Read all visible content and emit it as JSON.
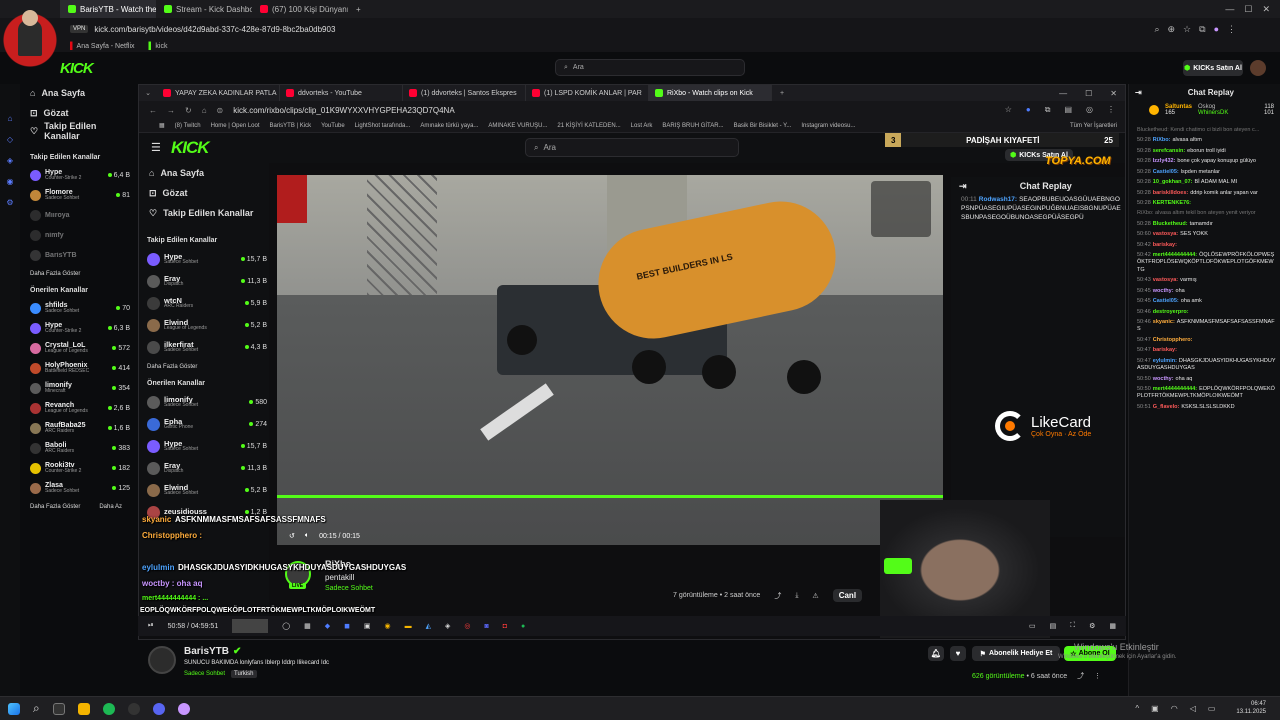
{
  "outer_tabs": [
    {
      "label": "BarisYTB - Watch the",
      "active": true
    },
    {
      "label": "Stream - Kick Dashboard",
      "active": false
    },
    {
      "label": "(67) 100 Kişi Dünyanın En",
      "active": false
    }
  ],
  "outer_address": "kick.com/barisytb/videos/d42d9abd-337c-428e-87d9-8bc2ba0db903",
  "outer_bookmarks": [
    "Ana Sayfa - Netflix",
    "kick"
  ],
  "outer_search_placeholder": "Ara",
  "kicks_buy_label": "KICKs Satın Al",
  "logo_text": "KICK",
  "outer_nav": {
    "home": "Ana Sayfa",
    "browse": "Gözat",
    "following": "Takip Edilen Kanallar"
  },
  "outer_followed_title": "Takip Edilen Kanallar",
  "outer_followed": [
    {
      "name": "Hype",
      "game": "Counter-Strike 2",
      "count": "6,4 B",
      "color": "#7a5cff"
    },
    {
      "name": "Flomore",
      "game": "Sadece Sohbet",
      "count": "81",
      "color": "#c0873a"
    },
    {
      "name": "Mııroya",
      "game": "",
      "count": "",
      "color": "#555"
    },
    {
      "name": "nimfy",
      "game": "",
      "count": "",
      "color": "#555"
    },
    {
      "name": "BarisYTB",
      "game": "",
      "count": "",
      "color": "#666"
    }
  ],
  "outer_show_more": "Daha Fazla Göster",
  "outer_recommended_title": "Önerilen Kanallar",
  "outer_recommended": [
    {
      "name": "shfilds",
      "game": "Sadece Sohbet",
      "count": "70",
      "color": "#3a8cff"
    },
    {
      "name": "Hype",
      "game": "Counter-Strike 2",
      "count": "6,3 B",
      "color": "#7a5cff"
    },
    {
      "name": "Crystal_LoL",
      "game": "League of Legends",
      "count": "572",
      "color": "#d86aa0"
    },
    {
      "name": "HolyPhoenix",
      "game": "Battlefield REDSEC",
      "count": "414",
      "color": "#c04a2a"
    },
    {
      "name": "limonify",
      "game": "Minecraft",
      "count": "354",
      "color": "#5b5b5b"
    },
    {
      "name": "Revanch",
      "game": "League of Legends",
      "count": "2,6 B",
      "color": "#aa3333"
    },
    {
      "name": "RaufBaba25",
      "game": "ARC Raiders",
      "count": "1,6 B",
      "color": "#887755"
    },
    {
      "name": "Baboli",
      "game": "ARC Raiders",
      "count": "383",
      "color": "#333"
    },
    {
      "name": "Rooki3tv",
      "game": "Counter-Strike 2",
      "count": "182",
      "color": "#e6c200"
    },
    {
      "name": "Zlasa",
      "game": "Sadece Sohbet",
      "count": "125",
      "color": "#9a6a4a"
    }
  ],
  "outer_show_more_2": "Daha Fazla Göster",
  "outer_show_less": "Daha Az",
  "inner_tabs": [
    {
      "label": "YAPAY ZEKA KADINLAR PATLA",
      "active": false
    },
    {
      "label": "ddvorteks - YouTube",
      "active": false
    },
    {
      "label": "(1) ddvorteks | Santos Ekspres",
      "active": false
    },
    {
      "label": "(1) LSPD KOMİK ANLAR | PAR",
      "active": false
    },
    {
      "label": "RiXbo - Watch clips on Kick",
      "active": true
    }
  ],
  "inner_address": "kick.com/rixbo/clips/clip_01K9WYXXVHYGPEHA23QD7Q4NA",
  "inner_bookmarks": [
    "(8) Twitch",
    "Home | Open Loot",
    "BarisYTB | Kick",
    "YouTube",
    "LightShot tarafında...",
    "Amınake türkü yaya...",
    "AMINAKE VURUŞU...",
    "21 KİŞİYİ KATLEDEN...",
    "Lost Ark",
    "BARIŞ BRUH GİTAR...",
    "Basik Bir Bisiklet - Y...",
    "Instagram videosu..."
  ],
  "inner_bookmarks_all": "Tüm Yer İşaretleri",
  "inner_search_placeholder": "Ara",
  "inner_nav": {
    "home": "Ana Sayfa",
    "browse": "Gözat",
    "following": "Takip Edilen Kanallar"
  },
  "inner_followed_title": "Takip Edilen Kanallar",
  "inner_followed": [
    {
      "name": "Hype",
      "game": "Sadece Sohbet",
      "count": "15,7 B",
      "color": "#7a5cff"
    },
    {
      "name": "Eray",
      "game": "Dispatch",
      "count": "11,3 B",
      "color": "#5a5a5a"
    },
    {
      "name": "wtcN",
      "game": "ARC Raiders",
      "count": "5,9 B",
      "color": "#3b3b3b"
    },
    {
      "name": "Elwind",
      "game": "League of Legends",
      "count": "5,2 B",
      "color": "#8a6a4a"
    },
    {
      "name": "ilkerfirat",
      "game": "Sadece Sohbet",
      "count": "4,3 B",
      "color": "#4a4a4a"
    }
  ],
  "inner_show_more": "Daha Fazla Göster",
  "inner_recommended_title": "Önerilen Kanallar",
  "inner_recommended": [
    {
      "name": "limonify",
      "game": "Sadece Sohbet",
      "count": "580",
      "color": "#5b5b5b"
    },
    {
      "name": "Epha",
      "game": "Gartic Phone",
      "count": "274",
      "color": "#3a6ad8"
    },
    {
      "name": "Hype",
      "game": "Sadece Sohbet",
      "count": "15,7 B",
      "color": "#7a5cff"
    },
    {
      "name": "Eray",
      "game": "Dispatch",
      "count": "11,3 B",
      "color": "#5a5a5a"
    },
    {
      "name": "Elwind",
      "game": "Sadece Sohbet",
      "count": "5,2 B",
      "color": "#8a6a4a"
    },
    {
      "name": "zeusidiouss",
      "game": "",
      "count": "1,2 B",
      "color": "#aa4444"
    }
  ],
  "padisah_label": "PADİŞAH KIYAFETİ",
  "padisah_left": "3",
  "padisah_right": "25",
  "inner_kicks_buy": "KICKs Satın Al",
  "overlay_brand": "TOPYA.COM",
  "truck_text": "BEST BUILDERS IN LS",
  "video_time": "00:15 / 00:15",
  "inner_chat_title": "Chat Replay",
  "inner_chat_msg": {
    "time": "00:11",
    "user": "Rodwash17:",
    "text": "SEAOPBUBEUOASGÜUAEBNGOPSNPÜASEGIUPÜASEGINPUĞBNUAEISBGNUPÜAESBUNPASEGOÜBUNOASEGPÜÄSEGPÜ"
  },
  "likecard": {
    "title": "LikeCard",
    "subtitle": "Çok Oyna · Az Öde"
  },
  "clip_author": "RiXbo",
  "clip_title": "pentakill",
  "clip_category": "Sadece Sohbet",
  "clip_views": "7 görüntüleme",
  "clip_age": "2 saat önce",
  "clip_action": "Canl",
  "live_badge": "LIVE",
  "stream_overlay_lines": [
    "ASFKNMMASFMSAFSAFSASSFMNAFS",
    "Christopphero :",
    "DHASGKJDUASYIDKHUGASYKHDUYASDUYGASHDUYGAS",
    "woctby : oha aq",
    "mert4444444444 : ...",
    "EOPLÖQWKÖRFPOLQWEKÖPLOTFRTÖKMEWPLTKMÖPLOIKWEÖMT"
  ],
  "overlay_names": [
    "skyanic",
    "Christopphero",
    "eylulmin",
    "woctby",
    "mert4444444444"
  ],
  "player_time": "50:58 / 04:59:51",
  "outer_chat_title": "Chat Replay",
  "outer_chat_leaders": [
    {
      "name": "Saltuntas",
      "value": "165"
    },
    {
      "name": "Oskog",
      "value": "118"
    },
    {
      "name": "WhinersDK",
      "value": "101"
    }
  ],
  "outer_chat": [
    {
      "time": "",
      "user": "",
      "cls": "",
      "text": "Blucketheud: Kendi chatimo ci bizli bon ateyen c..."
    },
    {
      "time": "50:28",
      "user": "RiXbo:",
      "cls": "b",
      "text": "alvasa altım"
    },
    {
      "time": "50:28",
      "user": "serefcansin:",
      "cls": "g",
      "text": "eborun troll iyidi"
    },
    {
      "time": "50:28",
      "user": "Izzly432:",
      "cls": "p",
      "text": "bone çok yapay konuşup gülüyo"
    },
    {
      "time": "50:28",
      "user": "Castiel05:",
      "cls": "b",
      "text": "lspden metanlar"
    },
    {
      "time": "50:28",
      "user": "10_gokhan_07:",
      "cls": "g",
      "text": "Bİ ADAM MAL MI"
    },
    {
      "time": "50:28",
      "user": "bariskilldoes:",
      "cls": "r",
      "text": "ddrip komik anlar yapan var"
    },
    {
      "time": "50:28",
      "user": "KERTENKE76:",
      "cls": "g",
      "text": ""
    },
    {
      "time": "",
      "user": "",
      "cls": "",
      "text": "RiXbo: alvasa altım tekil bon ateyen yenit veriyor"
    },
    {
      "time": "50:28",
      "user": "Blucketheud:",
      "cls": "g",
      "text": "tamamdır"
    },
    {
      "time": "50:60",
      "user": "vastosya:",
      "cls": "r",
      "text": "SES YOKK"
    },
    {
      "time": "50:42",
      "user": "bariskay:",
      "cls": "r",
      "text": ""
    },
    {
      "time": "50:42",
      "user": "mert4444444444:",
      "cls": "g",
      "text": "ÖQLÖSEWPRÖFKÖLOPWEŞÖKTFROPLÖSEWQKÖPTLOFÖKWEPLOTGÖFKMEWTG"
    },
    {
      "time": "50:43",
      "user": "vastosya:",
      "cls": "r",
      "text": "varmış"
    },
    {
      "time": "50:45",
      "user": "wocthy:",
      "cls": "p",
      "text": "oha"
    },
    {
      "time": "50:45",
      "user": "Castiel05:",
      "cls": "b",
      "text": "oha amk"
    },
    {
      "time": "50:46",
      "user": "destroyerpro:",
      "cls": "g",
      "text": ""
    },
    {
      "time": "50:46",
      "user": "skyanic:",
      "cls": "o",
      "text": "ASFKNMMASFMSAFSAFSASSFMNAFS"
    },
    {
      "time": "50:47",
      "user": "Christopphero:",
      "cls": "o",
      "text": ""
    },
    {
      "time": "50:47",
      "user": "bariskay:",
      "cls": "r",
      "text": ""
    },
    {
      "time": "50:47",
      "user": "eylulmin:",
      "cls": "b",
      "text": "DHASGKJDUASYIDKHUGASYKHDUYASDUYGASHDUYGAS"
    },
    {
      "time": "50:50",
      "user": "wocthy:",
      "cls": "p",
      "text": "oha aq"
    },
    {
      "time": "50:50",
      "user": "mert4444444444:",
      "cls": "g",
      "text": "EOPLÖQWKÖRFPOLQWEKÖPLOTFRTÖKMEWPLTKMÖPLOIKWEÖMT"
    },
    {
      "time": "50:51",
      "user": "G_flavelo:",
      "cls": "r",
      "text": "KSKSLSLSLSLDKKD"
    }
  ],
  "streamer_name": "BarisYTB",
  "stream_title": "SUNUCU BAKIMDA lonlyfans Iblerp Iddrp Ilikecard Idc",
  "stream_category": "Sadece Sohbet",
  "stream_language": "Turkish",
  "gift_sub_label": "Abonelik Hediye Et",
  "subscribe_label": "Abone Ol",
  "stream_views": "626 görüntüleme",
  "stream_age": "6 saat önce",
  "windows_activate": "Windows'u Etkinleştir",
  "windows_activate_sub": "Windows'u etkinleştirmek için Ayarlar'a gidin.",
  "clock_time": "06:47",
  "clock_date": "13.11.2025",
  "colors": {
    "kick_green": "#53fc18",
    "bg": "#0b0c0e"
  }
}
